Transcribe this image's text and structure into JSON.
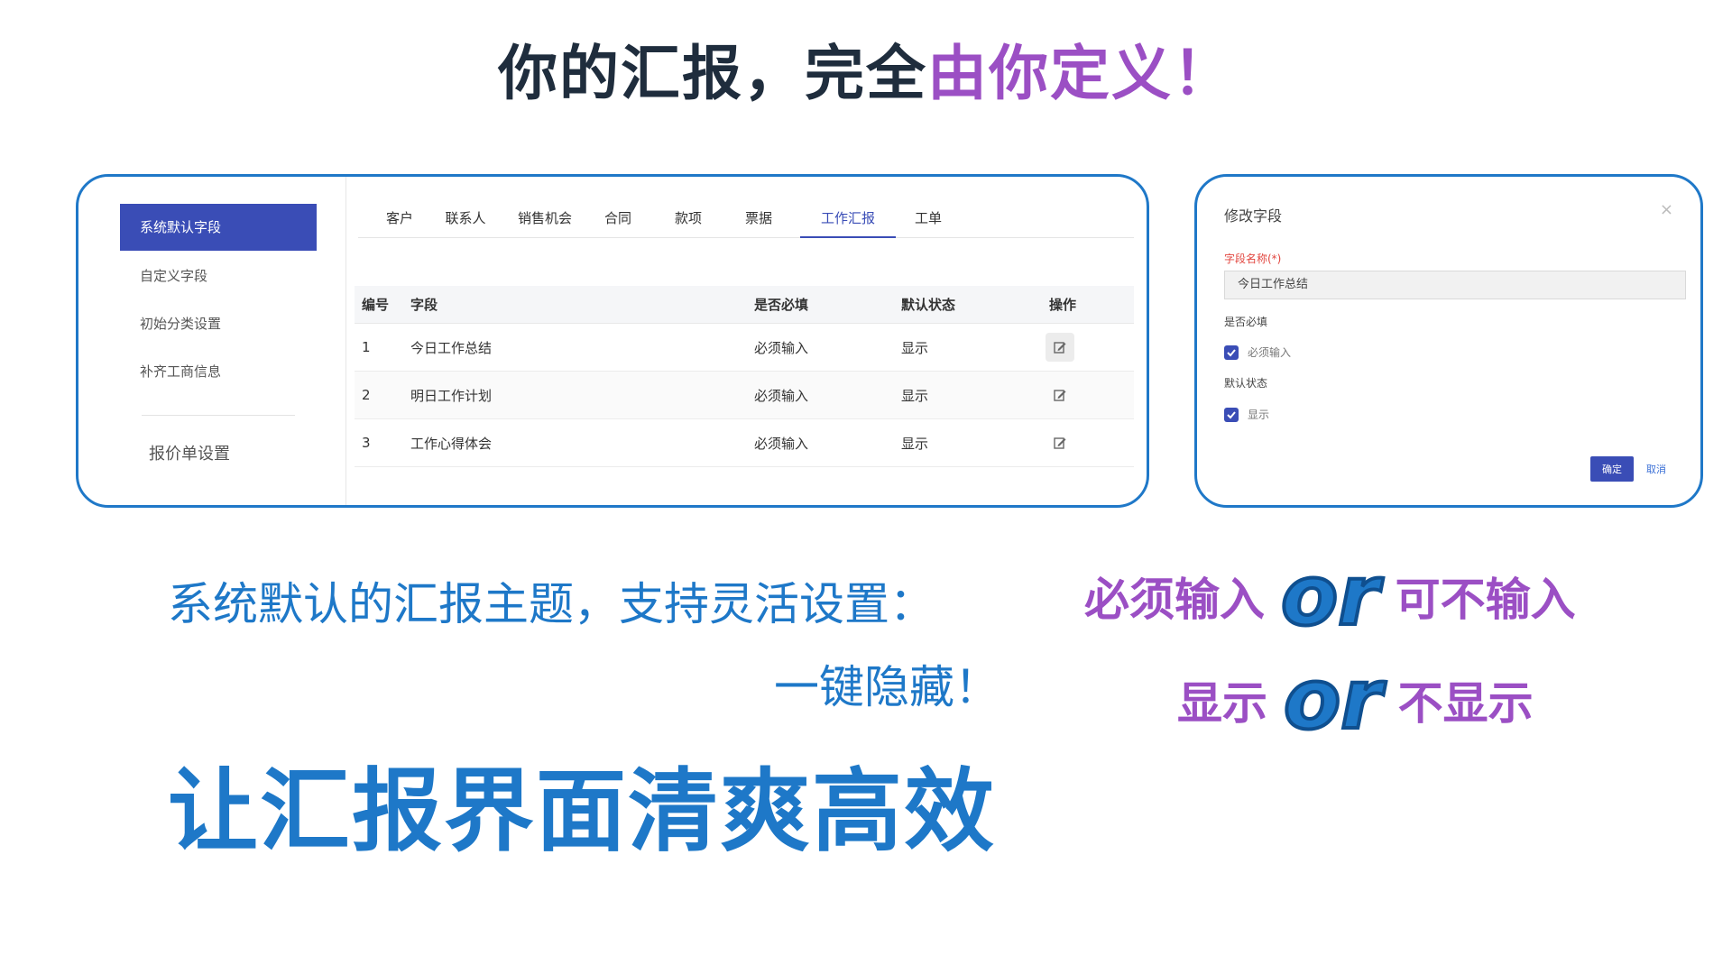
{
  "headline": {
    "dark": "你的汇报，完全",
    "purple": "由你定义！"
  },
  "sidebar": {
    "items": [
      {
        "label": "系统默认字段",
        "active": true
      },
      {
        "label": "自定义字段"
      },
      {
        "label": "初始分类设置"
      },
      {
        "label": "补齐工商信息"
      }
    ],
    "footer_item": "报价单设置"
  },
  "tabs": [
    {
      "label": "客户"
    },
    {
      "label": "联系人"
    },
    {
      "label": "销售机会"
    },
    {
      "label": "合同"
    },
    {
      "label": "款项"
    },
    {
      "label": "票据"
    },
    {
      "label": "工作汇报",
      "active": true
    },
    {
      "label": "工单"
    }
  ],
  "table": {
    "headers": [
      "编号",
      "字段",
      "是否必填",
      "默认状态",
      "操作"
    ],
    "rows": [
      {
        "id": "1",
        "field": "今日工作总结",
        "required": "必须输入",
        "state": "显示"
      },
      {
        "id": "2",
        "field": "明日工作计划",
        "required": "必须输入",
        "state": "显示"
      },
      {
        "id": "3",
        "field": "工作心得体会",
        "required": "必须输入",
        "state": "显示"
      }
    ]
  },
  "dialog": {
    "title": "修改字段",
    "close": "×",
    "name_label": "字段名称(*)",
    "name_value": "今日工作总结",
    "required_label": "是否必填",
    "required_checkbox": "必须输入",
    "state_label": "默认状态",
    "state_checkbox": "显示",
    "ok": "确定",
    "cancel": "取消"
  },
  "subtitle_line1": "系统默认的汇报主题，支持灵活设置：",
  "subtitle_line2": "一键隐藏！",
  "big_slogan": "让汇报界面清爽高效",
  "options": {
    "row1": {
      "left": "必须输入",
      "or": "or",
      "right": "可不输入"
    },
    "row2": {
      "left": "显示",
      "or": "or",
      "right": "不显示"
    }
  },
  "colors": {
    "accent_blue": "#3a4db6",
    "frame_blue": "#1f78c8",
    "purple": "#9b4fc4"
  }
}
